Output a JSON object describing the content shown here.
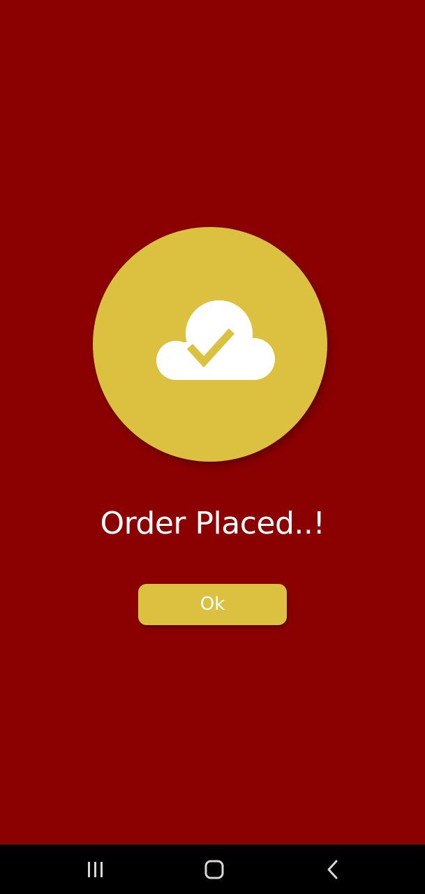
{
  "colors": {
    "background": "#8b0000",
    "accent": "#dbc13f",
    "text": "#ffffff",
    "nav_bar": "#000000"
  },
  "status": {
    "icon": "cloud-check-icon",
    "title": "Order Placed..!"
  },
  "actions": {
    "ok_label": "Ok"
  },
  "system_nav": {
    "recents_icon": "recents-icon",
    "home_icon": "home-icon",
    "back_icon": "back-icon"
  }
}
